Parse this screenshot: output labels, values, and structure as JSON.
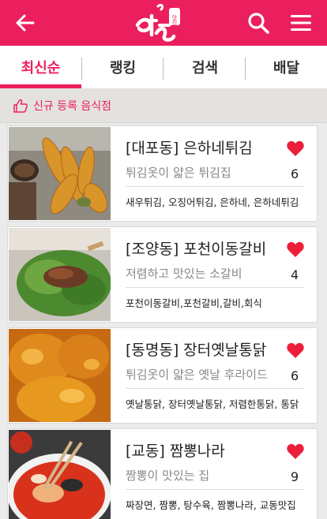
{
  "header": {
    "logo_badge": "맛집",
    "colors": {
      "brand": "#ec1f5e",
      "white": "#ffffff"
    },
    "icons": {
      "back": "arrow-left-icon",
      "search": "search-icon",
      "menu": "hamburger-menu-icon"
    }
  },
  "tabs": [
    {
      "label": "최신순",
      "active": true
    },
    {
      "label": "랭킹",
      "active": false
    },
    {
      "label": "검색",
      "active": false
    },
    {
      "label": "배달",
      "active": false
    }
  ],
  "section": {
    "label": "신규 등록 음식점",
    "icon": "thumbs-up-icon"
  },
  "restaurants": [
    {
      "title": "[대포동] 은하네튀김",
      "description": "튀김옷이 얇은 튀김집",
      "likes": "6",
      "tags": "새우튀김, 오징어튀김, 은하네, 은하네튀김"
    },
    {
      "title": "[조양동] 포천이동갈비",
      "description": "저렴하고 맛있는 소갈비",
      "likes": "4",
      "tags": "포천이동갈비,포천갈비,갈비,회식"
    },
    {
      "title": "[동명동] 장터옛날통닭",
      "description": "튀김옷이 얇은 옛날 후라이드",
      "likes": "6",
      "tags": "옛날통닭, 장터옛날통닭, 저렴한통닭, 통닭"
    },
    {
      "title": "[교동] 짬뽕나라",
      "description": "짬뽕이 맛있는 집",
      "likes": "9",
      "tags": "짜장면, 짬뽕, 탕수육, 짬뽕나라, 교동맛집"
    }
  ]
}
